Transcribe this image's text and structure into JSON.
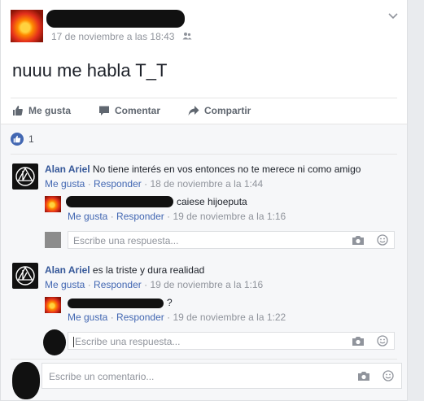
{
  "post": {
    "timestamp": "17 de noviembre a las 18:43",
    "privacy_icon": "friends-icon",
    "text": "nuuu me habla T_T"
  },
  "actions": {
    "like": "Me gusta",
    "comment": "Comentar",
    "share": "Compartir"
  },
  "likes": {
    "count": "1"
  },
  "comments": [
    {
      "author": "Alan Ariel",
      "text": "No tiene interés en vos entonces no te merece ni como amigo",
      "like": "Me gusta",
      "reply": "Responder",
      "time": "18 de noviembre a la 1:44",
      "replies": [
        {
          "text": "caiese hijoeputa",
          "like": "Me gusta",
          "reply": "Responder",
          "time": "19 de noviembre a la 1:16"
        }
      ],
      "reply_placeholder": "Escribe una respuesta..."
    },
    {
      "author": "Alan Ariel",
      "text": "es la triste y dura realidad",
      "like": "Me gusta",
      "reply": "Responder",
      "time": "19 de noviembre a la 1:16",
      "replies": [
        {
          "text": "?",
          "like": "Me gusta",
          "reply": "Responder",
          "time": "19 de noviembre a la 1:22"
        }
      ],
      "reply_placeholder": "Escribe una respuesta..."
    }
  ],
  "comment_placeholder": "Escribe un comentario...",
  "separator": "·",
  "colors": {
    "link": "#365899",
    "meta": "#90949c",
    "accent": "#4267b2"
  }
}
